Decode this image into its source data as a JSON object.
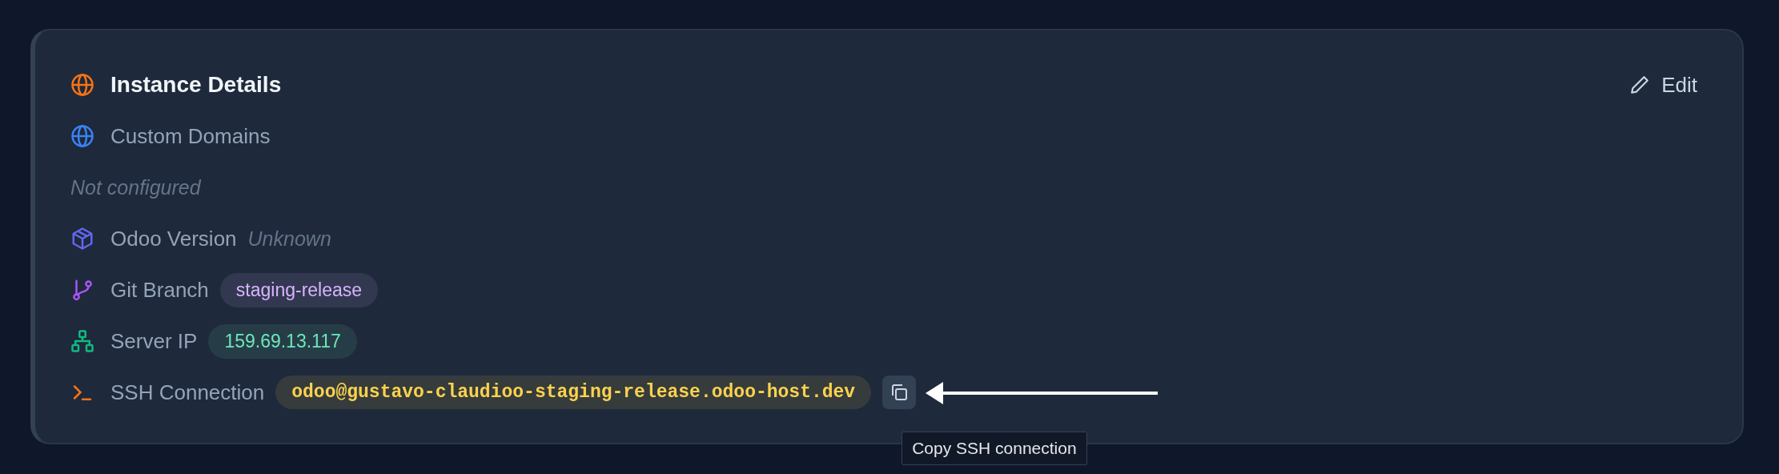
{
  "card": {
    "title": "Instance Details",
    "edit_label": "Edit"
  },
  "rows": [
    {
      "kind": "label",
      "label": "Custom Domains"
    },
    {
      "kind": "note",
      "text": "Not configured"
    },
    {
      "kind": "inline_note",
      "label": "Odoo Version",
      "value": "Unknown"
    },
    {
      "kind": "pill",
      "label": "Git Branch",
      "value": "staging-release",
      "color": "#d8b4fe"
    },
    {
      "kind": "pill",
      "label": "Server IP",
      "value": "159.69.13.117",
      "color": "#6ee7b7"
    },
    {
      "kind": "copy",
      "label": "SSH Connection",
      "value": "odoo@gustavo-claudioo-staging-release.odoo-host.dev",
      "color": "#fcd34d",
      "tooltip": "Copy SSH connection"
    }
  ]
}
